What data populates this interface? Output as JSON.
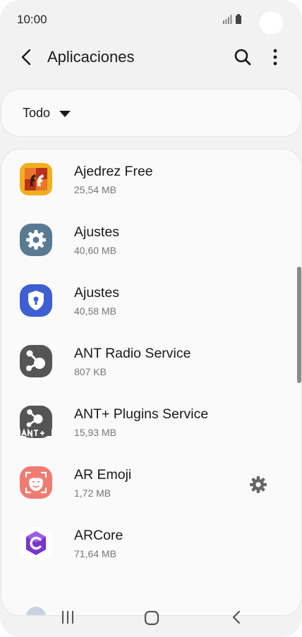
{
  "status_bar": {
    "time": "10:00",
    "signal_icon": "signal-icon",
    "battery_icon": "battery-icon"
  },
  "app_bar": {
    "title": "Aplicaciones",
    "back_icon": "back-arrow-icon",
    "search_icon": "search-icon",
    "more_icon": "more-vert-icon"
  },
  "filter": {
    "label": "Todo",
    "caret_icon": "caret-down-icon"
  },
  "apps": [
    {
      "name": "Ajedrez Free",
      "size": "25,54 MB",
      "icon": "chess-app-icon",
      "color": "#e9a21b"
    },
    {
      "name": "Ajustes",
      "size": "40,60 MB",
      "icon": "settings-gear-app-icon",
      "color": "#5a7a93"
    },
    {
      "name": "Ajustes",
      "size": "40,58 MB",
      "icon": "shield-lock-app-icon",
      "color": "#3d5fd1"
    },
    {
      "name": "ANT Radio Service",
      "size": "807 KB",
      "icon": "ant-radio-app-icon",
      "color": "#555555"
    },
    {
      "name": "ANT+ Plugins Service",
      "size": "15,93 MB",
      "icon": "ant-plus-app-icon",
      "color": "#555555"
    },
    {
      "name": "AR Emoji",
      "size": "1,72 MB",
      "icon": "ar-emoji-app-icon",
      "color": "#ef7b73"
    },
    {
      "name": "ARCore",
      "size": "71,64 MB",
      "icon": "arcore-app-icon",
      "color": "#7a35c9"
    }
  ],
  "ar_emoji_settings_icon": "gear-icon",
  "nav_bar": {
    "recents_icon": "recents-icon",
    "home_icon": "home-icon",
    "back_icon": "nav-back-icon"
  }
}
